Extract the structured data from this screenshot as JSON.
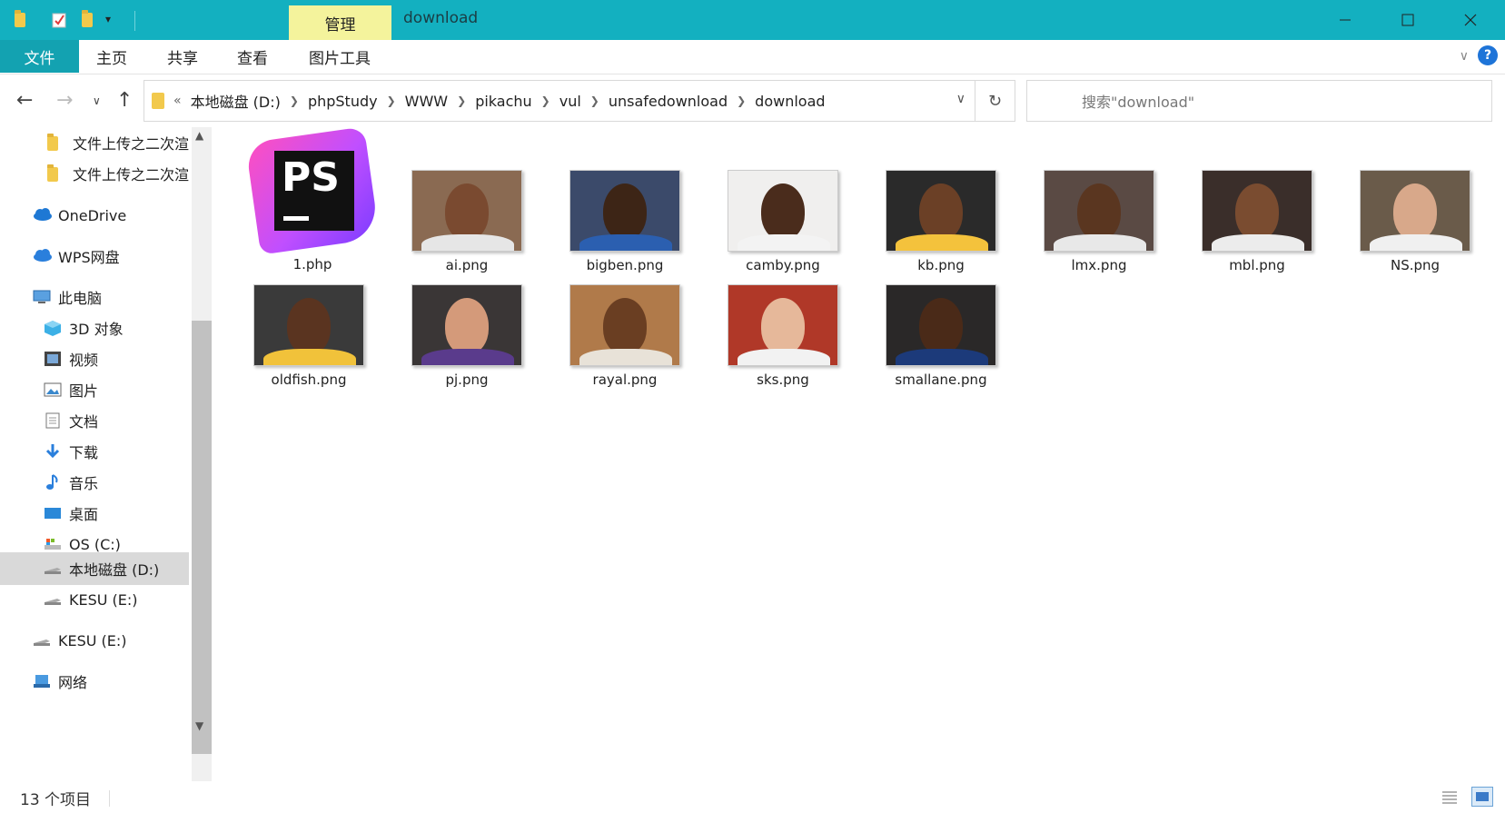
{
  "titlebar": {
    "context_tab": "管理",
    "title": "download",
    "minimize": "—",
    "maximize": "☐",
    "close": "✕"
  },
  "ribbon": {
    "tabs": [
      "文件",
      "主页",
      "共享",
      "查看",
      "图片工具"
    ],
    "help": "?",
    "expand": "∨"
  },
  "address": {
    "overflow": "«",
    "crumbs": [
      "本地磁盘 (D:)",
      "phpStudy",
      "WWW",
      "pikachu",
      "vul",
      "unsafedownload",
      "download"
    ],
    "dropdown": "∨",
    "refresh": "↻",
    "search_placeholder": "搜索\"download\""
  },
  "nav": {
    "back": "←",
    "forward": "→",
    "recent": "∨",
    "up": "↑"
  },
  "sidebar": {
    "items": [
      {
        "label": "文件上传之二次渲染",
        "icon": "folder-icon"
      },
      {
        "label": "文件上传之二次渲染",
        "icon": "folder-icon"
      },
      {
        "label": "OneDrive",
        "icon": "cloud-icon"
      },
      {
        "label": "WPS网盘",
        "icon": "cloud-icon"
      },
      {
        "label": "此电脑",
        "icon": "computer-icon"
      },
      {
        "label": "3D 对象",
        "icon": "cube-icon"
      },
      {
        "label": "视频",
        "icon": "video-icon"
      },
      {
        "label": "图片",
        "icon": "picture-icon"
      },
      {
        "label": "文档",
        "icon": "document-icon"
      },
      {
        "label": "下载",
        "icon": "download-icon"
      },
      {
        "label": "音乐",
        "icon": "music-icon"
      },
      {
        "label": "桌面",
        "icon": "desktop-icon"
      },
      {
        "label": "OS (C:)",
        "icon": "drive-icon"
      },
      {
        "label": "本地磁盘 (D:)",
        "icon": "drive-icon"
      },
      {
        "label": "KESU (E:)",
        "icon": "drive-icon"
      },
      {
        "label": "KESU (E:)",
        "icon": "drive-icon"
      },
      {
        "label": "网络",
        "icon": "network-icon"
      }
    ],
    "selected_index": 13
  },
  "files": [
    {
      "name": "1.php",
      "type": "phpstorm",
      "icon_text": "PS"
    },
    {
      "name": "ai.png",
      "bg": "#8a6a52",
      "skin": "#7a4a30",
      "jersey": "#e6e6e6"
    },
    {
      "name": "bigben.png",
      "bg": "#3b4a6a",
      "skin": "#3d2516",
      "jersey": "#2b5fb0"
    },
    {
      "name": "camby.png",
      "bg": "#f0efee",
      "skin": "#4a2c1c",
      "jersey": "#f3f3f3"
    },
    {
      "name": "kb.png",
      "bg": "#2a2a2a",
      "skin": "#6b4026",
      "jersey": "#f4c23c"
    },
    {
      "name": "lmx.png",
      "bg": "#5a4a44",
      "skin": "#5a3620",
      "jersey": "#e8e8e8"
    },
    {
      "name": "mbl.png",
      "bg": "#3a2e2a",
      "skin": "#7a4c30",
      "jersey": "#ececec"
    },
    {
      "name": "NS.png",
      "bg": "#6a5b4a",
      "skin": "#d8a88a",
      "jersey": "#f0f0f0"
    },
    {
      "name": "oldfish.png",
      "bg": "#3a3a3a",
      "skin": "#5a3420",
      "jersey": "#f1c23a"
    },
    {
      "name": "pj.png",
      "bg": "#3a3636",
      "skin": "#d49a7a",
      "jersey": "#5a3b8c"
    },
    {
      "name": "rayal.png",
      "bg": "#b07a4a",
      "skin": "#6a3e22",
      "jersey": "#e8e2d8"
    },
    {
      "name": "sks.png",
      "bg": "#b03828",
      "skin": "#e6b89a",
      "jersey": "#f2f2f2"
    },
    {
      "name": "smallane.png",
      "bg": "#2a2828",
      "skin": "#4a2a18",
      "jersey": "#1c3a7a"
    }
  ],
  "status": {
    "count": "13 个项目"
  },
  "colors": {
    "titlebar": "#13b0c0",
    "context_tab": "#f4f39c",
    "file_tab": "#13a2b1",
    "selection": "#d9d9d9"
  }
}
